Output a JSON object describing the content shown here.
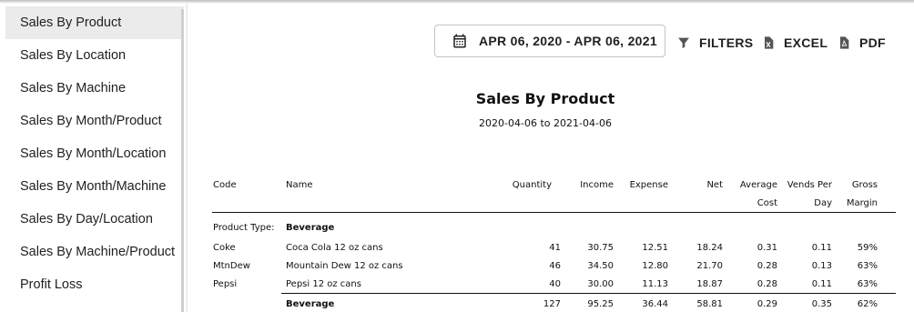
{
  "sidebar": {
    "items": [
      {
        "label": "Sales By Product",
        "active": true
      },
      {
        "label": "Sales By Location"
      },
      {
        "label": "Sales By Machine"
      },
      {
        "label": "Sales By Month/Product"
      },
      {
        "label": "Sales By Month/Location"
      },
      {
        "label": "Sales By Month/Machine"
      },
      {
        "label": "Sales By Day/Location"
      },
      {
        "label": "Sales By Machine/Product"
      },
      {
        "label": "Profit Loss"
      }
    ]
  },
  "toolbar": {
    "date_range": "APR 06, 2020 - APR 06, 2021",
    "filters_label": "FILTERS",
    "excel_label": "EXCEL",
    "pdf_label": "PDF"
  },
  "report": {
    "title": "Sales By Product",
    "subtitle": "2020-04-06 to 2021-04-06",
    "headers": {
      "code": "Code",
      "name": "Name",
      "quantity": "Quantity",
      "income": "Income",
      "expense": "Expense",
      "net": "Net",
      "avg_cost_1": "Average",
      "avg_cost_2": "Cost",
      "vends_1": "Vends Per",
      "vends_2": "Day",
      "margin_1": "Gross",
      "margin_2": "Margin"
    },
    "group_label": "Product Type:",
    "group_name": "Beverage",
    "rows": [
      {
        "code": "Coke",
        "name": "Coca Cola 12 oz cans",
        "quantity": "41",
        "income": "30.75",
        "expense": "12.51",
        "net": "18.24",
        "avg_cost": "0.31",
        "vends": "0.11",
        "margin": "59%"
      },
      {
        "code": "MtnDew",
        "name": "Mountain Dew 12 oz cans",
        "quantity": "46",
        "income": "34.50",
        "expense": "12.80",
        "net": "21.70",
        "avg_cost": "0.28",
        "vends": "0.13",
        "margin": "63%"
      },
      {
        "code": "Pepsi",
        "name": "Pepsi 12 oz cans",
        "quantity": "40",
        "income": "30.00",
        "expense": "11.13",
        "net": "18.87",
        "avg_cost": "0.28",
        "vends": "0.11",
        "margin": "63%"
      }
    ],
    "total": {
      "name": "Beverage",
      "quantity": "127",
      "income": "95.25",
      "expense": "36.44",
      "net": "58.81",
      "avg_cost": "0.29",
      "vends": "0.35",
      "margin": "62%"
    }
  },
  "icons": {
    "calendar": "calendar-icon",
    "filter": "filter-icon",
    "excel": "excel-file-icon",
    "pdf": "pdf-file-icon"
  }
}
